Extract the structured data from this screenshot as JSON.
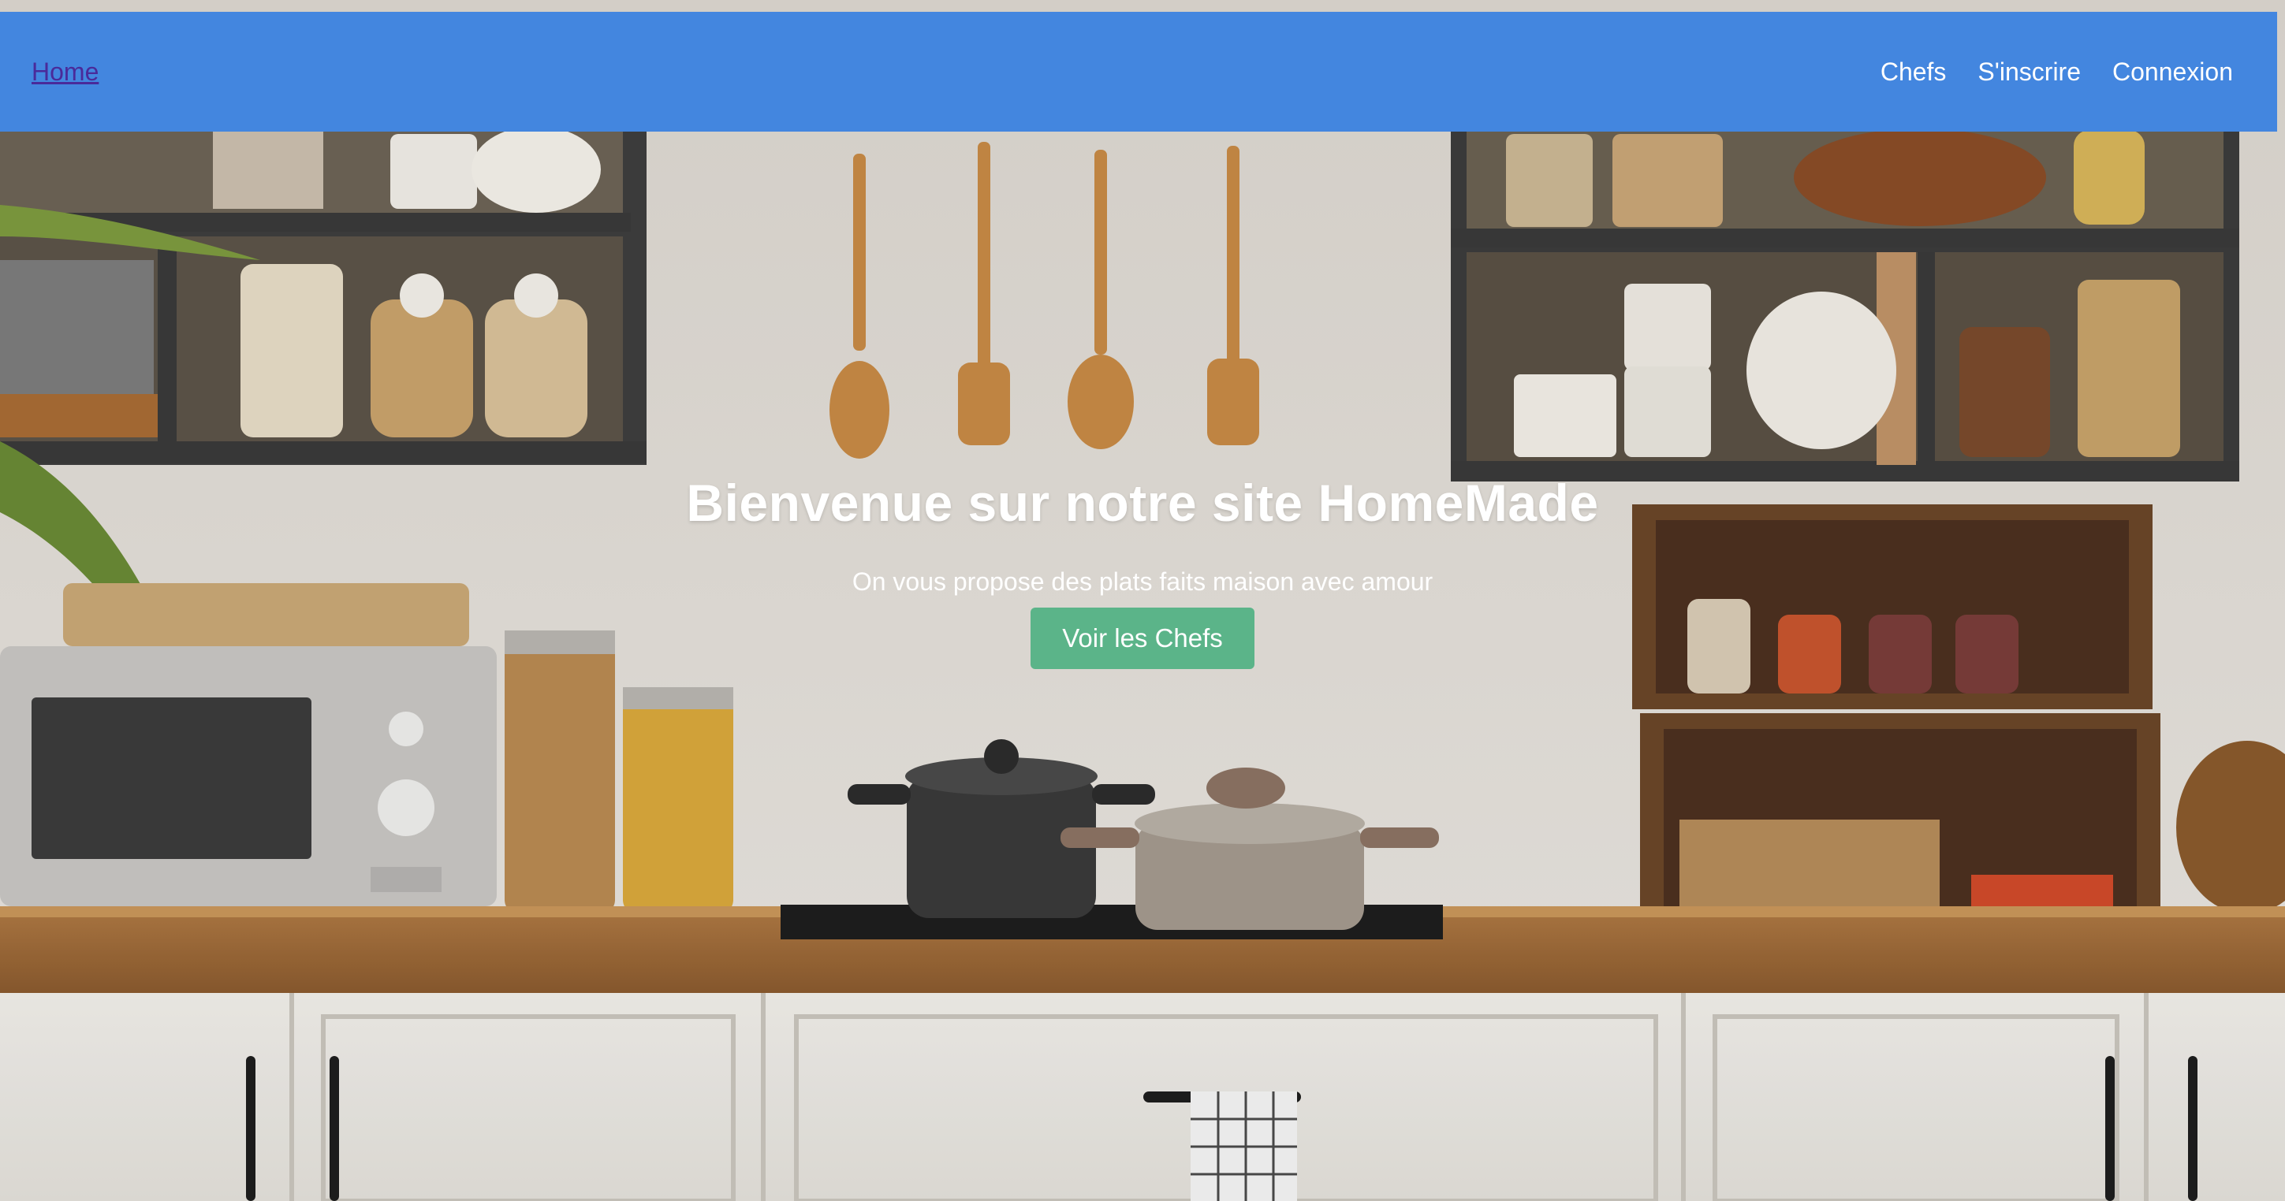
{
  "nav": {
    "home_label": "Home",
    "links": [
      "Chefs",
      "S'inscrire",
      "Connexion"
    ]
  },
  "hero": {
    "title": "Bienvenue sur notre site HomeMade",
    "subtitle": "On vous propose des plats faits maison avec amour",
    "button_label": "Voir les Chefs"
  },
  "colors": {
    "navbar": "#4386df",
    "button": "#5bb489",
    "home_link": "#4a2a9a"
  }
}
